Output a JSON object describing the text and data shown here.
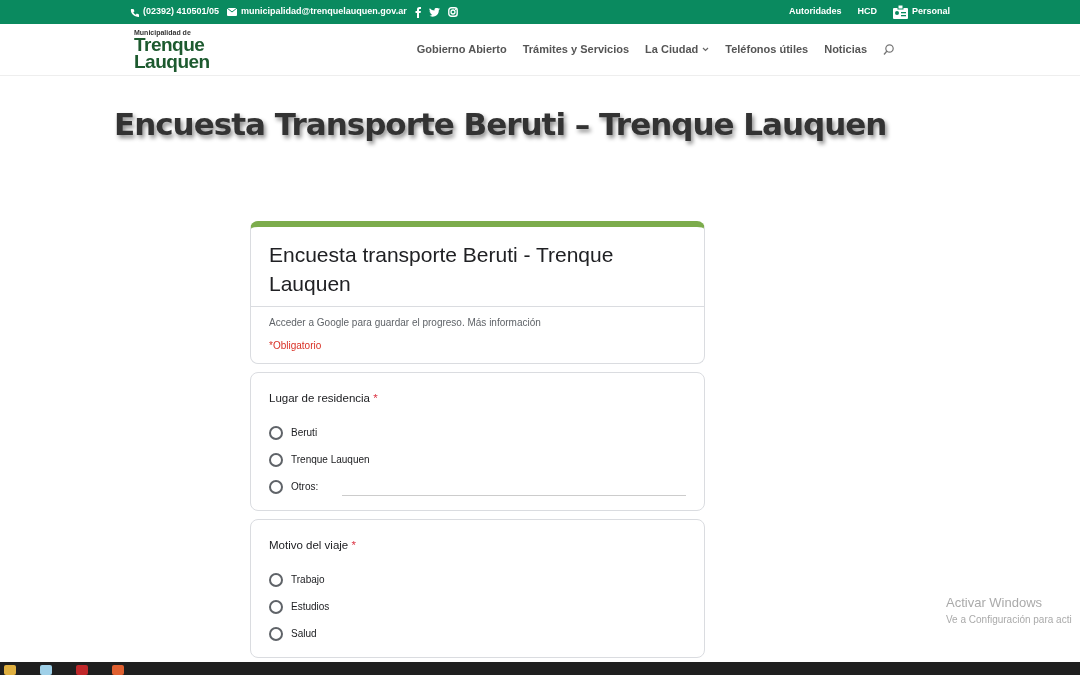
{
  "top_bar": {
    "phone": "(02392) 410501/05",
    "email": "municipalidad@trenquelauquen.gov.ar",
    "links": [
      "Autoridades",
      "HCD",
      "Personal"
    ]
  },
  "logo": {
    "small": "Municipalidad de",
    "line1": "Trenque",
    "line2": "Lauquen"
  },
  "nav": [
    {
      "label": "Gobierno Abierto",
      "dropdown": false
    },
    {
      "label": "Trámites y Servicios",
      "dropdown": false
    },
    {
      "label": "La Ciudad",
      "dropdown": true
    },
    {
      "label": "Teléfonos útiles",
      "dropdown": false
    },
    {
      "label": "Noticias",
      "dropdown": false
    }
  ],
  "page_title": "Encuesta Transporte Beruti – Trenque Lauquen",
  "form": {
    "title": "Encuesta transporte Beruti - Trenque Lauquen",
    "signin_link": "Acceder a Google",
    "signin_text": "para guardar el progreso.",
    "more_link": "Más información",
    "required_note": "*Obligatorio",
    "questions": [
      {
        "title": "Lugar de residencia",
        "required_mark": "*",
        "options": [
          {
            "label": "Beruti",
            "selected": false,
            "kind": "plain"
          },
          {
            "label": "Trenque Lauquen",
            "selected": false,
            "kind": "plain"
          },
          {
            "label": "Otros:",
            "selected": false,
            "kind": "other"
          }
        ]
      },
      {
        "title": "Motivo del viaje",
        "required_mark": "*",
        "options": [
          {
            "label": "Trabajo",
            "selected": false,
            "kind": "plain"
          },
          {
            "label": "Estudios",
            "selected": false,
            "kind": "plain"
          },
          {
            "label": "Salud",
            "selected": false,
            "kind": "plain"
          }
        ]
      }
    ]
  },
  "windows_notice": {
    "title": "Activar Windows",
    "subtitle": "Ve a Configuración para acti"
  }
}
